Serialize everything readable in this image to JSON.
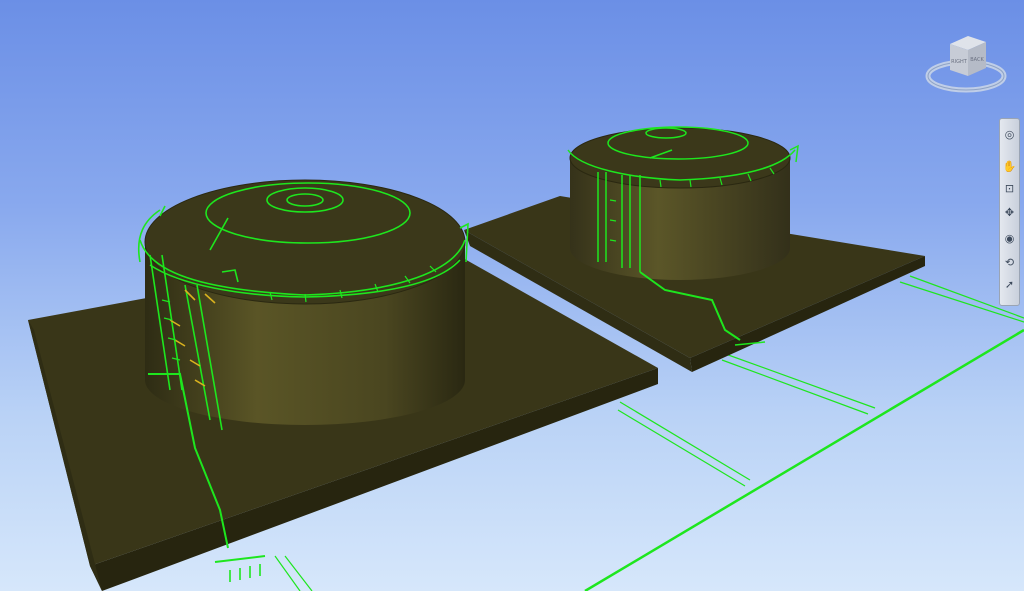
{
  "viewport": {
    "background_top": "#6b8fe6",
    "background_bottom": "#d6e7fb",
    "model_color": "#3e3b1c",
    "pipe_color": "#1ee61e",
    "support_color": "#d9b21e"
  },
  "viewcube": {
    "left_face_label": "RIGHT",
    "front_face_label": "BACK",
    "icon": "view-cube-icon"
  },
  "nav_bar": {
    "buttons": [
      {
        "name": "steering-wheel-icon",
        "glyph": "◎"
      },
      {
        "name": "pan-icon",
        "glyph": "✋"
      },
      {
        "name": "zoom-window-icon",
        "glyph": "⊡"
      },
      {
        "name": "orbit-icon",
        "glyph": "✥"
      },
      {
        "name": "look-icon",
        "glyph": "◉"
      },
      {
        "name": "walk-icon",
        "glyph": "⟲"
      },
      {
        "name": "select-icon",
        "glyph": "➚"
      }
    ]
  }
}
